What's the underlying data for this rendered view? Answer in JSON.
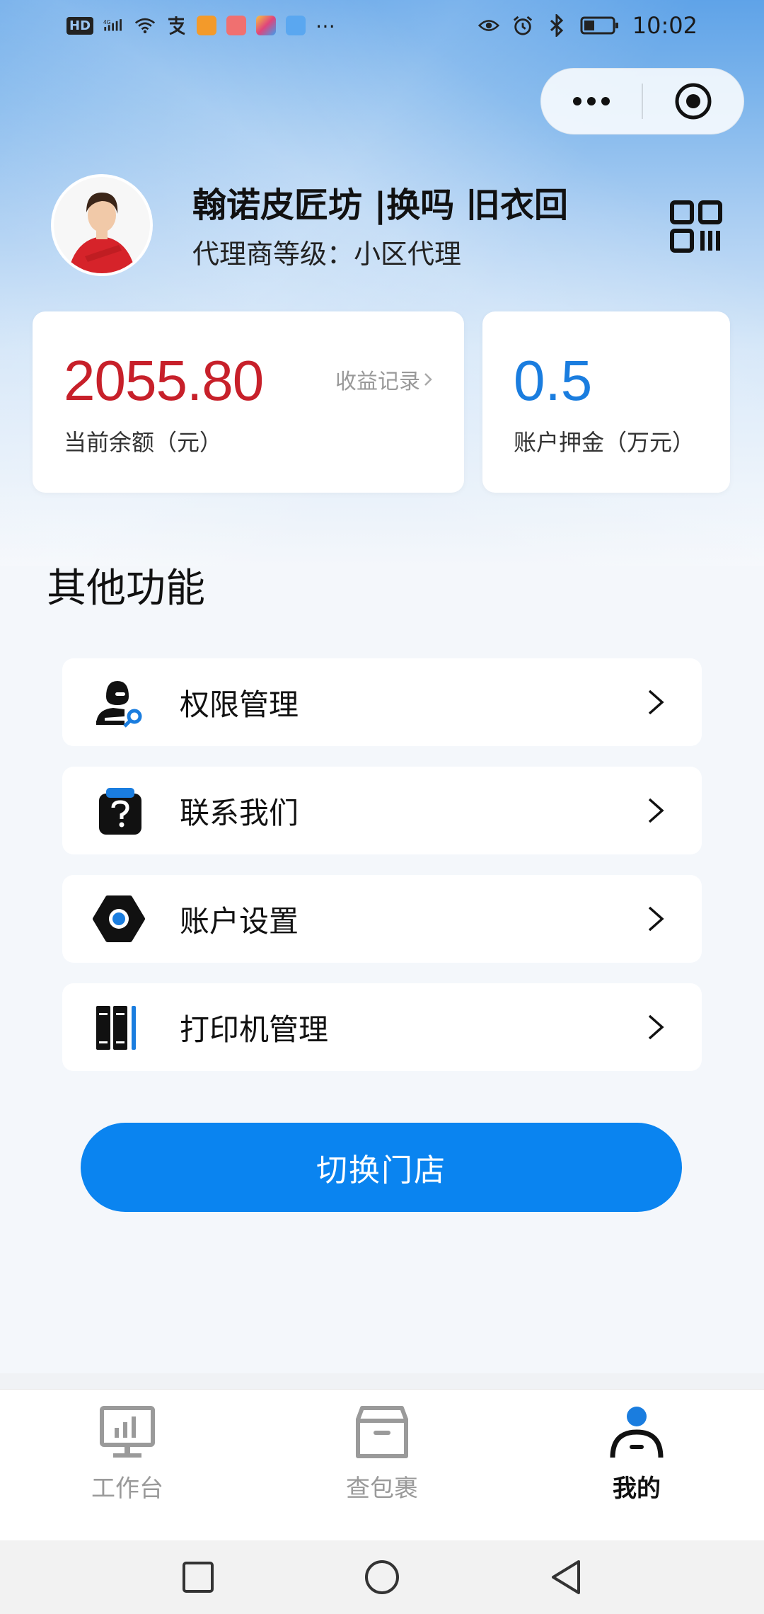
{
  "status_bar": {
    "network_badge": "HD",
    "signal_label": "4G",
    "time": "10:02"
  },
  "capsule": {
    "more_icon": "more-dots-icon",
    "close_icon": "target-icon"
  },
  "profile": {
    "shop_name": "翰诺皮匠坊 |换吗 旧衣回",
    "agent_level": "代理商等级：小区代理",
    "qr_icon": "qr-code-icon"
  },
  "balance_card": {
    "value": "2055.80",
    "label": "当前余额（元）",
    "link_label": "收益记录",
    "value_color": "#c7202a"
  },
  "deposit_card": {
    "value": "0.5",
    "label": "账户押金（万元）",
    "value_color": "#1a7ddf"
  },
  "section": {
    "title": "其他功能"
  },
  "menu_items": [
    {
      "label": "权限管理",
      "icon": "permission-user-key-icon"
    },
    {
      "label": "联系我们",
      "icon": "question-box-icon"
    },
    {
      "label": "账户设置",
      "icon": "settings-hexagon-icon"
    },
    {
      "label": "打印机管理",
      "icon": "printer-book-icon"
    }
  ],
  "switch_button": {
    "label": "切换门店",
    "color": "#0a84f0"
  },
  "tabbar": {
    "tabs": [
      {
        "label": "工作台",
        "icon": "workbench-monitor-icon",
        "active": false
      },
      {
        "label": "查包裹",
        "icon": "package-box-icon",
        "active": false
      },
      {
        "label": "我的",
        "icon": "profile-person-icon",
        "active": true
      }
    ]
  },
  "navbar": {
    "recent_icon": "square-icon",
    "home_icon": "circle-icon",
    "back_icon": "triangle-back-icon"
  }
}
